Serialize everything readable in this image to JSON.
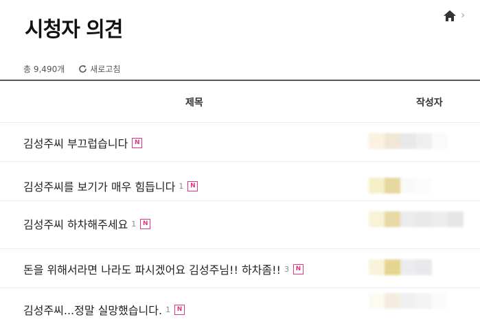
{
  "page": {
    "title": "시청자 의견"
  },
  "nav": {
    "home_icon": "home-icon",
    "chevron": "›"
  },
  "summary": {
    "total": "총 9,490개",
    "refresh_label": "새로고침"
  },
  "table": {
    "columns": {
      "title": "제목",
      "author": "작성자"
    },
    "rows": [
      {
        "title": "김성주씨 부끄럽습니다",
        "comments": "",
        "badge": "N"
      },
      {
        "title": "김성주씨를 보기가 매우 힘듭니다",
        "comments": "1",
        "badge": "N"
      },
      {
        "title": "김성주씨 하차해주세요",
        "comments": "1",
        "badge": "N"
      },
      {
        "title": "돈을 위해서라면 나라도 파시겠어요 김성주님!! 하차좀!!",
        "comments": "3",
        "badge": "N"
      },
      {
        "title": "김성주씨...정말 실망했습니다.",
        "comments": "1",
        "badge": "N"
      }
    ]
  },
  "colors": {
    "badge": "#e0357f",
    "divider": "#555555"
  }
}
